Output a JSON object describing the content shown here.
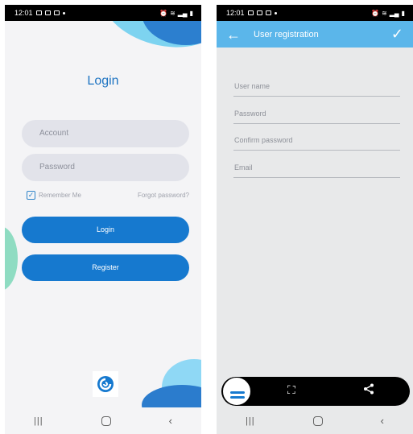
{
  "status": {
    "time": "12:01"
  },
  "login": {
    "title": "Login",
    "account_placeholder": "Account",
    "password_placeholder": "Password",
    "remember_label": "Remember Me",
    "remember_checked": true,
    "forgot_label": "Forgot password?",
    "login_button": "Login",
    "register_button": "Register"
  },
  "registration": {
    "title": "User registration",
    "fields": {
      "username": "User name",
      "password": "Password",
      "confirm_password": "Confirm password",
      "email": "Email"
    }
  },
  "icons": {
    "back": "arrow-left-icon",
    "confirm": "check-icon",
    "crop": "crop-edit-icon",
    "share": "share-icon"
  },
  "colors": {
    "accent": "#1679cf",
    "app_bar": "#5bb6ea",
    "title_text": "#1e74c2"
  }
}
